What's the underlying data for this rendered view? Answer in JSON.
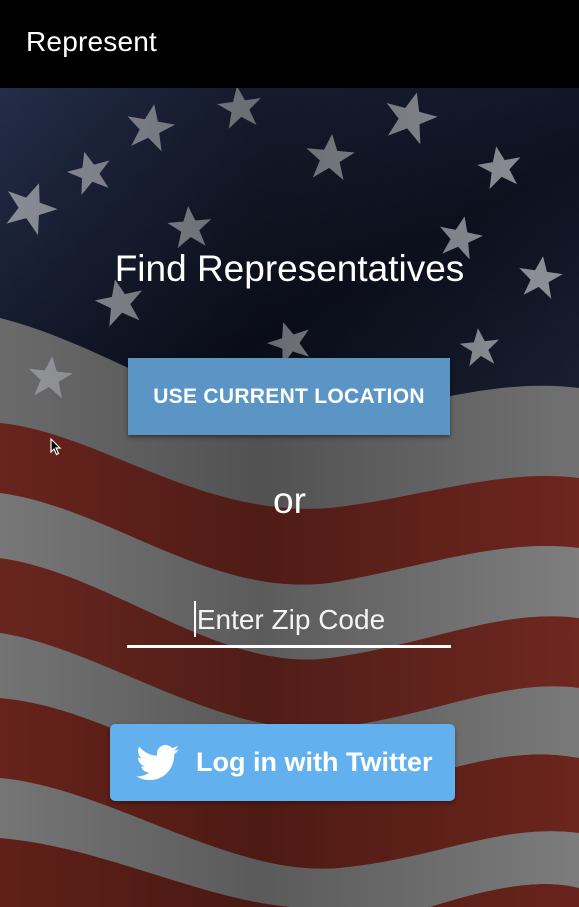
{
  "app_bar": {
    "title": "Represent"
  },
  "main": {
    "heading": "Find Representatives",
    "location_button_label": "USE CURRENT LOCATION",
    "separator": "or",
    "zip_input": {
      "value": "",
      "placeholder": "Enter Zip Code"
    },
    "twitter_button_label": "Log in with Twitter"
  },
  "icons": {
    "twitter": "twitter-bird-icon",
    "pointer": "mouse-pointer-icon"
  },
  "colors": {
    "app_bar": "#000000",
    "location_button": "#5b95c6",
    "twitter_button": "#62b0ee",
    "flag_blue": "#1e2a4a",
    "flag_red": "#7a2a22",
    "flag_white": "#8a8a8a"
  }
}
